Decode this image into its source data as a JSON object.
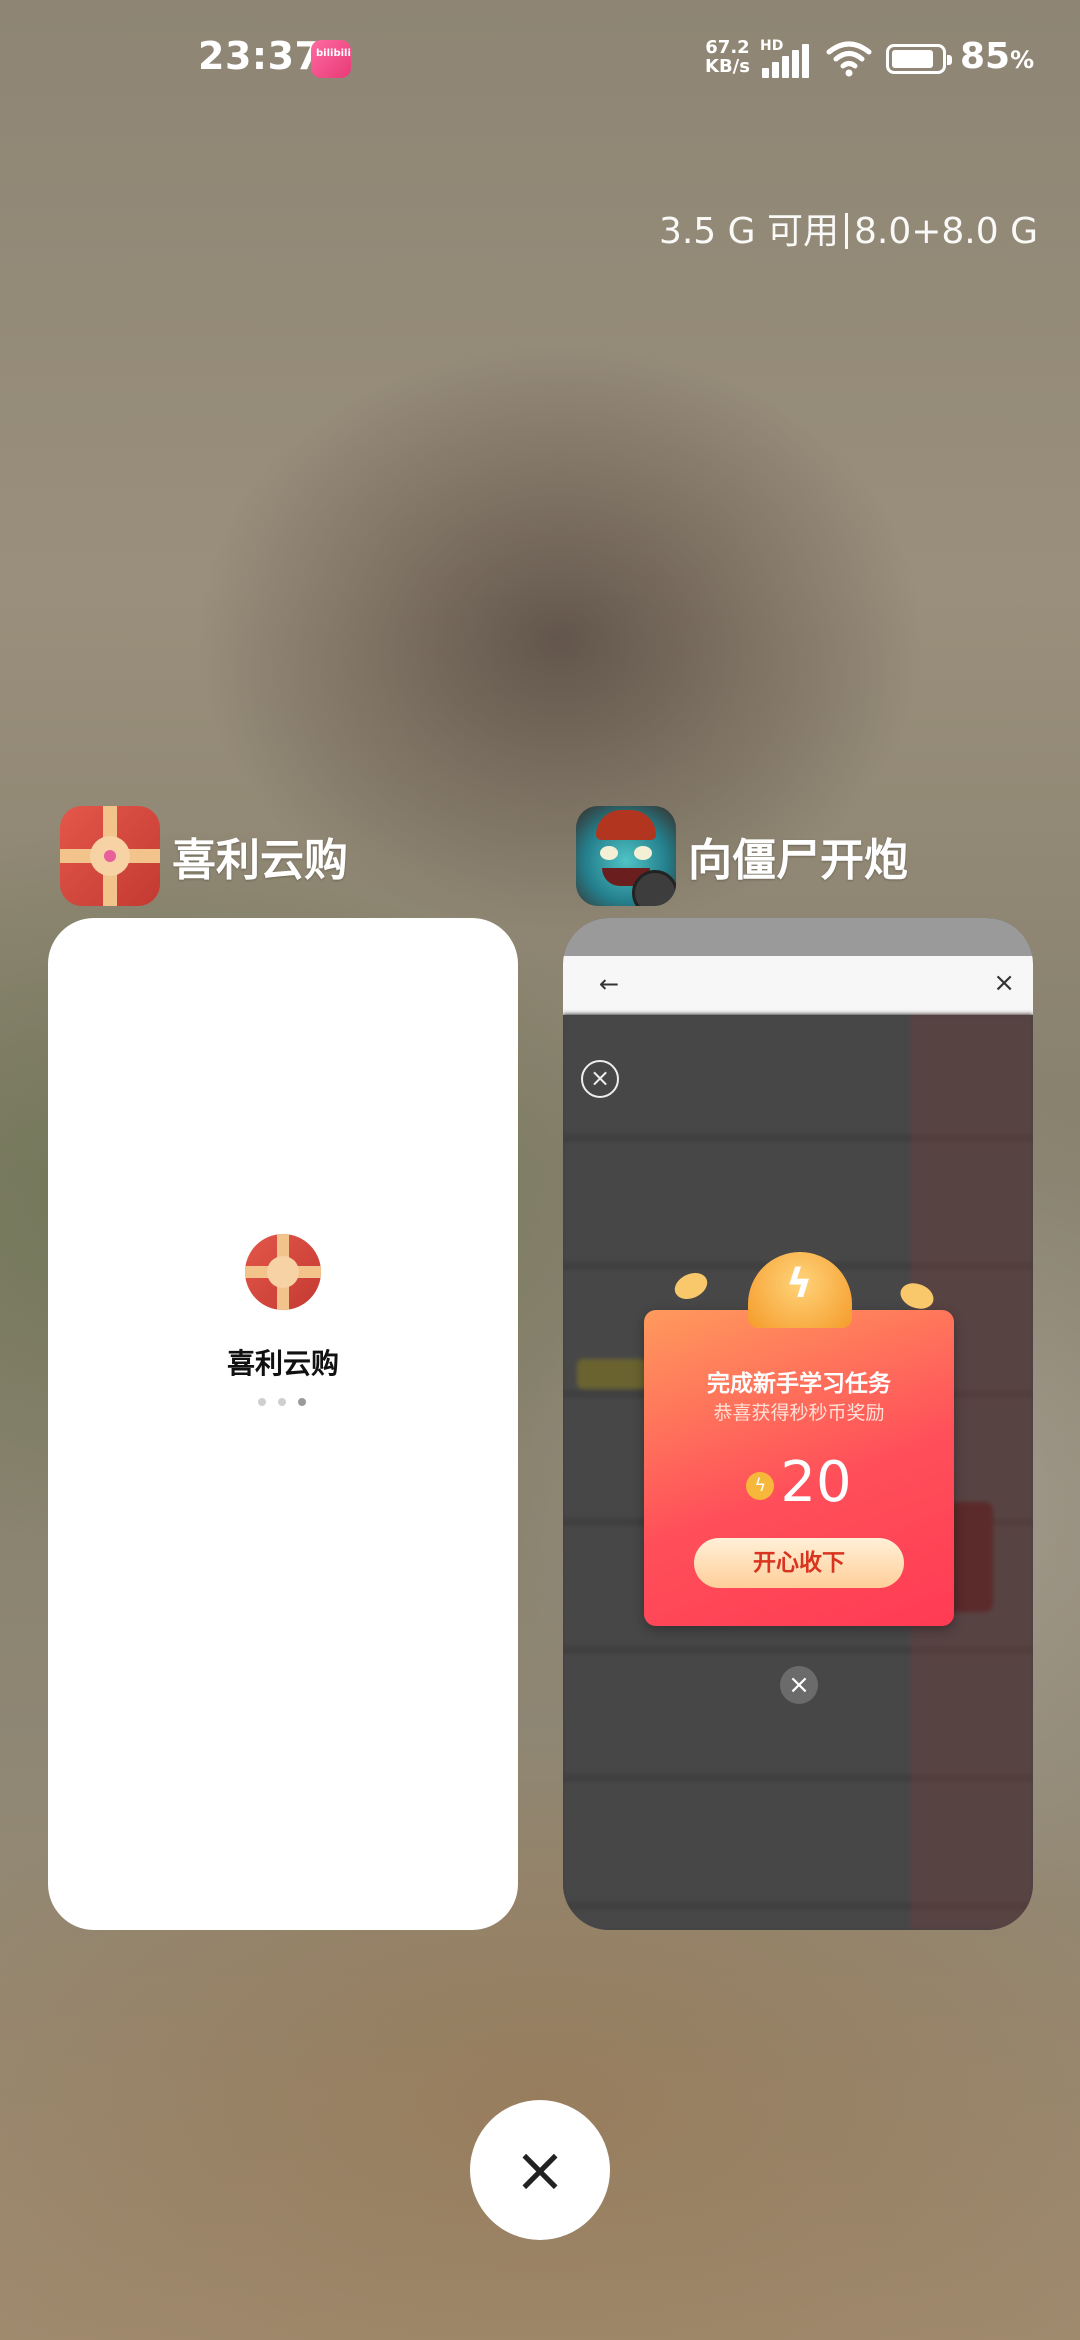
{
  "status_bar": {
    "time": "23:37",
    "net_speed_value": "67.2",
    "net_speed_unit": "KB/s",
    "network_badge": "HD",
    "battery_percent": "85",
    "battery_unit": "%",
    "battery_level": 0.85,
    "notification_app_label": "bilibili"
  },
  "memory": {
    "available": "3.5 G 可用",
    "total": "8.0+8.0 G"
  },
  "recent_apps": [
    {
      "name": "喜利云购",
      "splash_name": "喜利云购",
      "icon": "gift-icon"
    },
    {
      "name": "向僵尸开炮",
      "icon": "zombie-game-icon",
      "nav_back": "←",
      "nav_close": "×",
      "reward_popup": {
        "title": "完成新手学习任务",
        "subtitle": "恭喜获得秒秒币奖励",
        "amount": "20",
        "button_label": "开心收下"
      }
    }
  ],
  "clear_all_label": "×",
  "colors": {
    "reward_red": "#ff3b54",
    "reward_orange": "#ff9a5c",
    "gift_red": "#c33a32",
    "ribbon": "#f2c48b"
  }
}
